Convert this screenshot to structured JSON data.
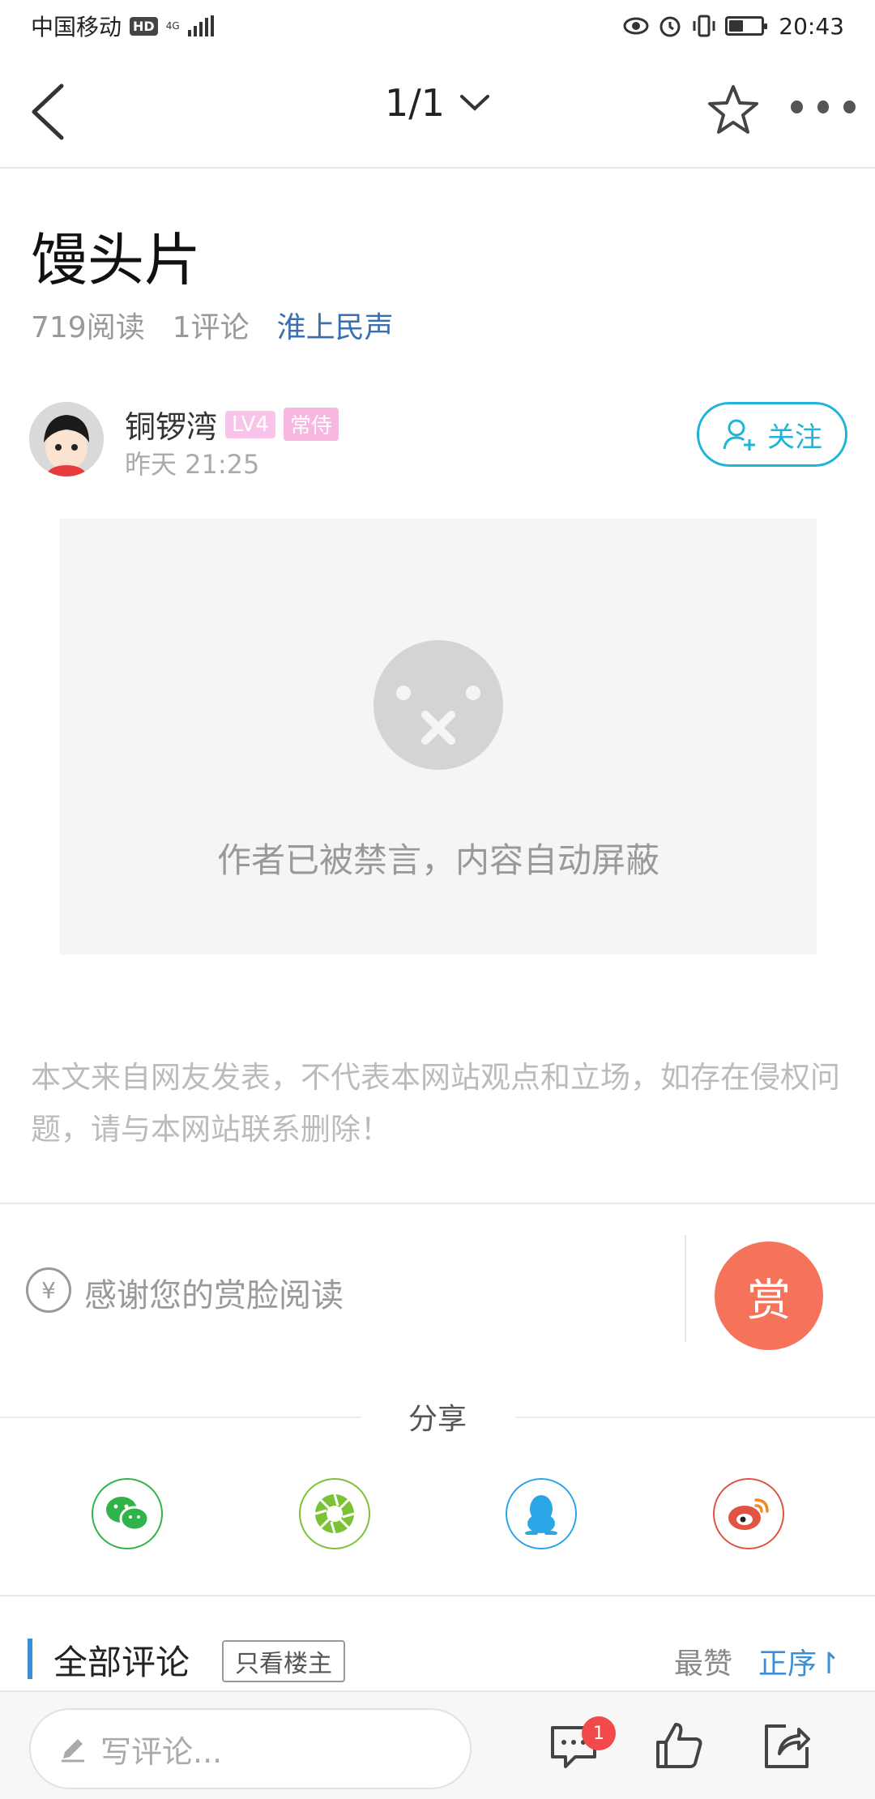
{
  "status_bar": {
    "carrier": "中国移动",
    "hd": "HD",
    "network": "4G",
    "time": "20:43",
    "icons": [
      "eye-icon",
      "alarm-icon",
      "vibrate-icon",
      "battery-icon"
    ]
  },
  "nav": {
    "page_indicator": "1/1",
    "icons": [
      "back-icon",
      "chevron-down-icon",
      "star-icon",
      "more-icon"
    ]
  },
  "article": {
    "title": "馒头片",
    "reads": "719阅读",
    "comments": "1评论",
    "section": "淮上民声"
  },
  "author": {
    "name": "铜锣湾",
    "level": "LV4",
    "role": "常侍",
    "time": "昨天 21:25",
    "follow_label": "关注"
  },
  "blocked": {
    "message": "作者已被禁言，内容自动屏蔽"
  },
  "disclaimer": "本文来自网友发表，不代表本网站观点和立场，如存在侵权问题，请与本网站联系删除！",
  "reward": {
    "icon_symbol": "¥",
    "text": "感谢您的赏脸阅读",
    "button_label": "赏",
    "button_color": "#f5735a"
  },
  "share": {
    "title": "分享",
    "targets": [
      {
        "name": "wechat-icon",
        "color": "#2fb34a"
      },
      {
        "name": "moments-icon",
        "color": "#7cc236"
      },
      {
        "name": "qq-icon",
        "color": "#2ba6e6"
      },
      {
        "name": "weibo-icon",
        "color": "#e05444"
      }
    ]
  },
  "comments": {
    "title": "全部评论",
    "owner_only": "只看楼主",
    "sort_hot": "最赞",
    "sort_order": "正序↾",
    "accent": "#3a8fd6"
  },
  "bottom_bar": {
    "input_placeholder": "写评论...",
    "unread_count": "1"
  }
}
